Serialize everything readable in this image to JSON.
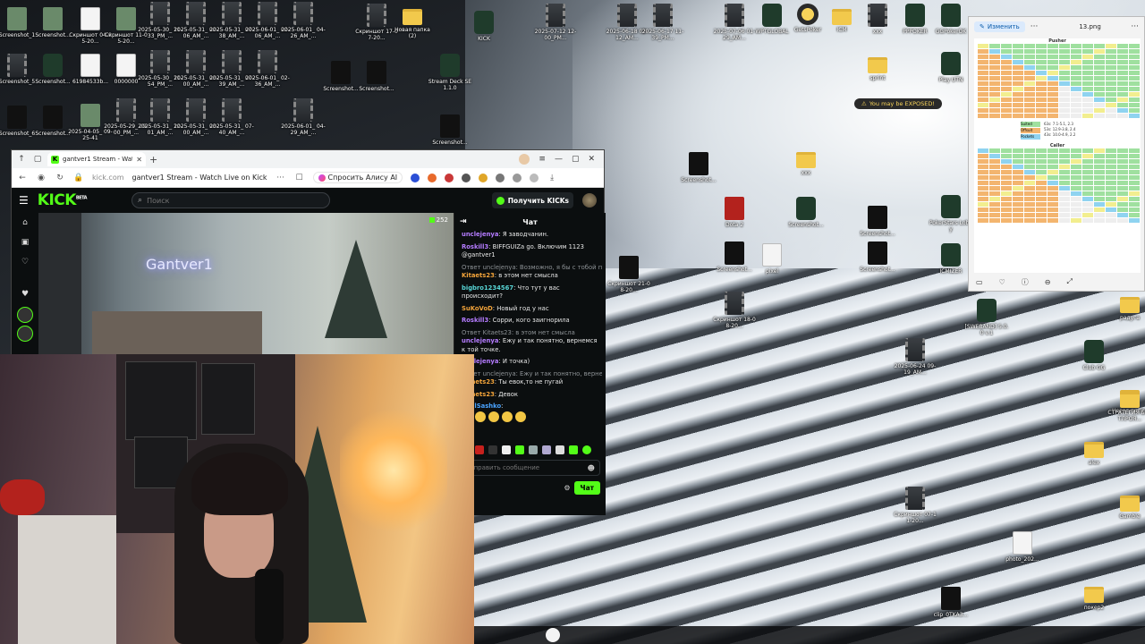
{
  "browser": {
    "tab_title": "gantver1 Stream - Watc",
    "url_host": "kick.com",
    "page_title": "gantver1 Stream - Watch Live on Kick",
    "alice_label": "Спросить Алису AI"
  },
  "kick": {
    "logo": "KICK",
    "logo_tag": "BETA",
    "search_placeholder": "Поиск",
    "get_kicks_label": "Получить KICKs",
    "viewer_count": "252",
    "stream_neon": "Gantver1"
  },
  "chat": {
    "title": "Чат",
    "messages": [
      {
        "user": "unclejenya",
        "color": "purple",
        "text": ": Я заводчанин."
      },
      {
        "user": "Roskill3",
        "color": "purple",
        "text": ": BIFFGUIZa go. Включим 1123 @gantver1"
      },
      {
        "reply": "Ответ unclejenya: Возможно, я бы с тобой по...",
        "user": "Kitaets23",
        "color": "orange",
        "text": ": в этом нет смысла"
      },
      {
        "user": "bigbro1234567",
        "color": "teal",
        "text": ": Что тут у вас происходит?"
      },
      {
        "user": "SuKoVoD",
        "color": "orange",
        "text": ": Новый год у нас"
      },
      {
        "user": "Roskill3",
        "color": "purple",
        "text": ": Сорри, кого заигнорила"
      },
      {
        "reply": "Ответ Kitaets23: в этом нет смысла",
        "user": "unclejenya",
        "color": "purple",
        "text": ": Ежу и так понятно, вернемся к той точке."
      },
      {
        "user": "unclejenya",
        "color": "purple",
        "text": ": И точка)"
      },
      {
        "reply": "Ответ unclejenya: Ежу и так понятно, вернем...",
        "user": "Kitaets23",
        "color": "orange",
        "text": ": Ты евок,то не пугай"
      },
      {
        "user": "Kitaets23",
        "color": "orange",
        "text": ": Девок"
      },
      {
        "user": "RealSashko",
        "color": "blue",
        "text": ":"
      }
    ],
    "input_placeholder": "Отправить сообщение",
    "points": "102",
    "send_label": "Чат"
  },
  "desktop_icons": [
    {
      "label": "Screenshot_1",
      "kind": "shot"
    },
    {
      "label": "Screenshot...",
      "kind": "shot"
    },
    {
      "label": "Скриншот 04-05-20...",
      "kind": "doc"
    },
    {
      "label": "Скриншот 11-05-20...",
      "kind": "shot"
    },
    {
      "label": "2025-05-30_ 11-33_PM_...",
      "kind": "film"
    },
    {
      "label": "2025-05-31_ 02-06_AM_...",
      "kind": "film"
    },
    {
      "label": "2025-05-31_ 07-38_AM_...",
      "kind": "film"
    },
    {
      "label": "2025-06-01_ 02-06_AM_...",
      "kind": "film"
    },
    {
      "label": "2025-06-01_ 04-26_AM_...",
      "kind": "film"
    },
    {
      "label": "Скриншот 17-07-20...",
      "kind": "film"
    },
    {
      "label": "Новая папка (2)",
      "kind": "folder"
    },
    {
      "label": "Screenshot_5",
      "kind": "film"
    },
    {
      "label": "Screenshot...",
      "kind": "app"
    },
    {
      "label": "61984533b...",
      "kind": "doc"
    },
    {
      "label": "0000000",
      "kind": "doc"
    },
    {
      "label": "2025-05-30_ 11-54_PM_...",
      "kind": "film"
    },
    {
      "label": "2025-05-31_ 03-00_AM_...",
      "kind": "film"
    },
    {
      "label": "2025-05-31_ 07-39_AM_...",
      "kind": "film"
    },
    {
      "label": "2025-06-01_ 02-36_AM_...",
      "kind": "film"
    },
    {
      "label": "Screenshot...",
      "kind": "dark"
    },
    {
      "label": "Screenshot...",
      "kind": "dark"
    },
    {
      "label": "Screenshot_6",
      "kind": "dark"
    },
    {
      "label": "Screenshot...",
      "kind": "dark"
    },
    {
      "label": "2025-04-05_ 09-25-41",
      "kind": "shot"
    },
    {
      "label": "2025-05-29_ 09-00_PM_...",
      "kind": "film"
    },
    {
      "label": "2025-05-31_ 12-01_AM_...",
      "kind": "film"
    },
    {
      "label": "2025-05-31_ 03-00_AM_...",
      "kind": "film"
    },
    {
      "label": "2025-05-31_ 07-40_AM_...",
      "kind": "film"
    },
    {
      "label": "2025-06-01_ 04-29_AM_...",
      "kind": "film"
    },
    {
      "label": "Screenshot...",
      "kind": "dark"
    },
    {
      "label": "KICK",
      "kind": "app"
    },
    {
      "label": "Stream Deck SE 1.1.0",
      "kind": "app"
    },
    {
      "label": "2025-07-12 12-00_PM...",
      "kind": "film"
    },
    {
      "label": "2025-06-18 02-12_AM...",
      "kind": "film"
    },
    {
      "label": "2025-06-17 11-39_PM...",
      "kind": "film"
    },
    {
      "label": "2025-07-06 01-29_AM...",
      "kind": "film"
    },
    {
      "label": "WPTGLOBAL",
      "kind": "app"
    },
    {
      "label": "GetsPoker",
      "kind": "gold"
    },
    {
      "label": "ICM",
      "kind": "folder"
    },
    {
      "label": "xxx",
      "kind": "film"
    },
    {
      "label": "PPPOKER",
      "kind": "app"
    },
    {
      "label": "GGPokerOK",
      "kind": "app"
    },
    {
      "label": "Скриншот 18-08-20...",
      "kind": "film"
    },
    {
      "label": "Screenshot...",
      "kind": "dark"
    },
    {
      "label": "Dota 2",
      "kind": "red"
    },
    {
      "label": "Screenshot...",
      "kind": "app"
    },
    {
      "label": "Screenshot...",
      "kind": "dark"
    },
    {
      "label": "PokerStars Lobby",
      "kind": "app"
    },
    {
      "label": "ICMIZER",
      "kind": "app"
    },
    {
      "label": "Play UTN",
      "kind": "app"
    },
    {
      "label": "sprint",
      "kind": "folder"
    },
    {
      "label": "xxx",
      "kind": "folder"
    },
    {
      "label": "Скриншот 21-08-20...",
      "kind": "dark"
    },
    {
      "label": "pixel",
      "kind": "doc"
    },
    {
      "label": "Screenshot...",
      "kind": "dark"
    },
    {
      "label": "Screenshot...",
      "kind": "dark"
    },
    {
      "label": "[SWEBAND] 5.0.0 v.1",
      "kind": "app"
    },
    {
      "label": "радуга",
      "kind": "folder"
    },
    {
      "label": "2025-06-24 09-19_AM...",
      "kind": "film"
    },
    {
      "label": "Club GG",
      "kind": "app"
    },
    {
      "label": "Новая папка",
      "kind": "folder"
    },
    {
      "label": "СТРАТЕГИЯ БАТТЛРОЯ...",
      "kind": "folder"
    },
    {
      "label": "alex",
      "kind": "folder"
    },
    {
      "label": "Скриншот 07-11-20...",
      "kind": "film"
    },
    {
      "label": "Gamble",
      "kind": "folder"
    },
    {
      "label": "photo_202...",
      "kind": "doc"
    },
    {
      "label": "покер2",
      "kind": "folder"
    },
    {
      "label": "clip_0TKA3...",
      "kind": "dark"
    }
  ],
  "viewer": {
    "edit_label": "Изменить",
    "file_name": "13.png",
    "section1": "Pusher",
    "section2": "Caller",
    "legend": [
      "Suited",
      "Offsuit",
      "Pockets"
    ],
    "ranges": [
      "63s: 7.1-5.1, 2.3",
      "53s: 12.9-3.8, 2.4",
      "43s: 10.0-4.9, 2.2"
    ]
  },
  "toast": {
    "text": "You may be EXPOSED!"
  },
  "colors": {
    "kick_green": "#53fc18",
    "kick_bg": "#0b0e0f",
    "chat_user_purple": "#b57cff",
    "chat_user_orange": "#f2a33a"
  }
}
